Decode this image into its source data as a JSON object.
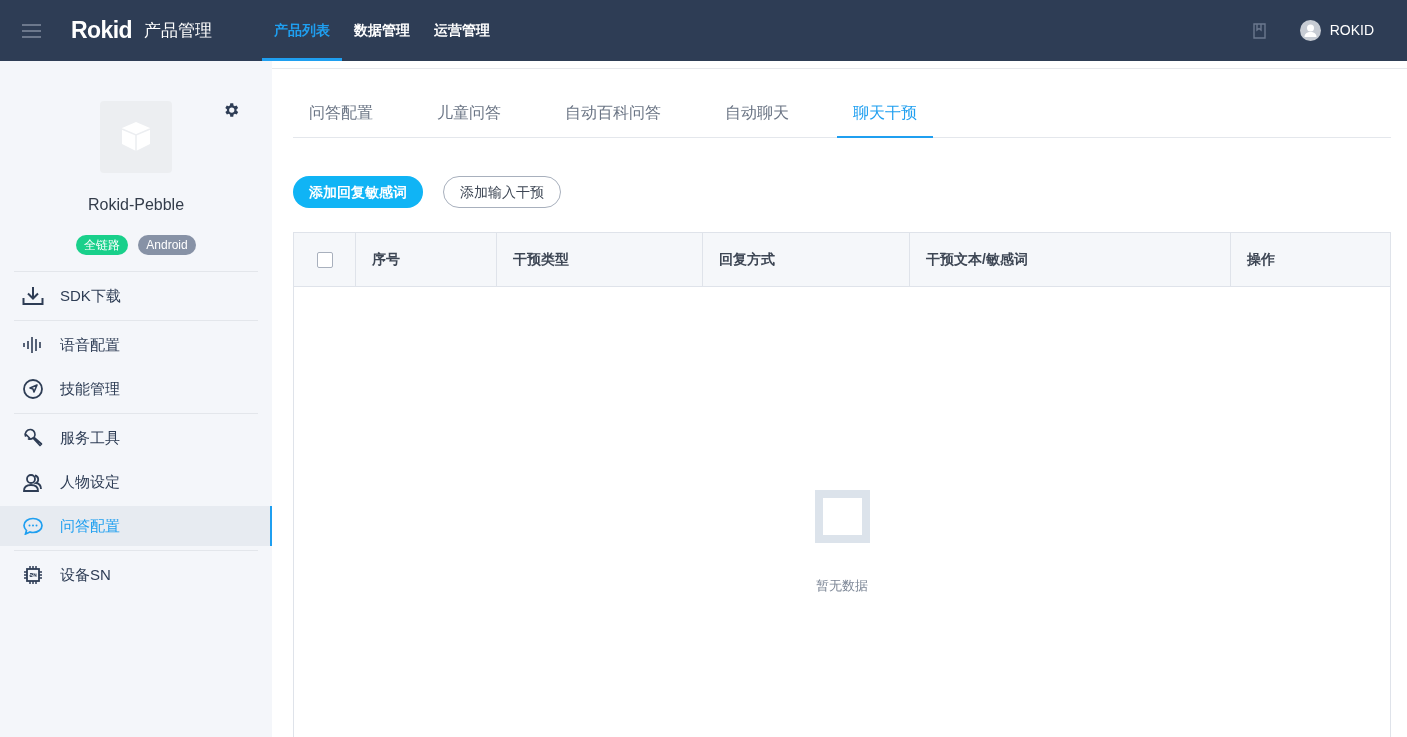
{
  "header": {
    "logo": "Rokid",
    "title": "产品管理",
    "nav": [
      {
        "label": "产品列表",
        "selected": true
      },
      {
        "label": "数据管理",
        "selected": false
      },
      {
        "label": "运营管理",
        "selected": false
      }
    ],
    "user": "ROKID"
  },
  "sidebar": {
    "product_name": "Rokid-Pebble",
    "tags": [
      {
        "label": "全链路",
        "color": "#19d08b"
      },
      {
        "label": "Android",
        "color": "#8792a6"
      }
    ],
    "groups": [
      [
        {
          "label": "SDK下载",
          "selected": false
        }
      ],
      [
        {
          "label": "语音配置",
          "selected": false
        },
        {
          "label": "技能管理",
          "selected": false
        }
      ],
      [
        {
          "label": "服务工具",
          "selected": false
        },
        {
          "label": "人物设定",
          "selected": false
        },
        {
          "label": "问答配置",
          "selected": true
        }
      ],
      [
        {
          "label": "设备SN",
          "selected": false
        }
      ]
    ]
  },
  "tabs": [
    {
      "label": "问答配置",
      "selected": false
    },
    {
      "label": "儿童问答",
      "selected": false
    },
    {
      "label": "自动百科问答",
      "selected": false
    },
    {
      "label": "自动聊天",
      "selected": false
    },
    {
      "label": "聊天干预",
      "selected": true
    }
  ],
  "actions": [
    {
      "label": "添加回复敏感词",
      "kind": "primary"
    },
    {
      "label": "添加输入干预",
      "kind": "outline"
    }
  ],
  "table": {
    "select_all": {
      "checked": false
    },
    "columns": [
      "序号",
      "干预类型",
      "回复方式",
      "干预文本/敏感词",
      "操作"
    ],
    "empty_text": "暂无数据"
  }
}
